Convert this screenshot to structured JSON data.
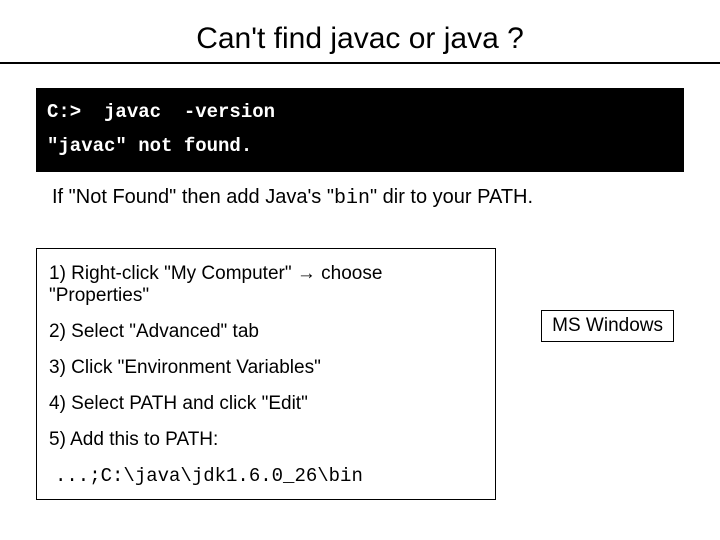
{
  "title": "Can't find javac or java ?",
  "terminal": {
    "line1": "C:>  javac  -version",
    "line2": "\"javac\" not found."
  },
  "instruction": {
    "prefix": "If \"Not Found\" then add Java's \"",
    "bin": "bin",
    "suffix": "\" dir to your PATH."
  },
  "steps": {
    "s1": "1) Right-click \"My Computer\" → choose \"Properties\"",
    "s2": "2) Select \"Advanced\" tab",
    "s3": "3) Click \"Environment Variables\"",
    "s4": "4) Select PATH and click \"Edit\"",
    "s5": "5) Add this to PATH:",
    "path": "...;C:\\java\\jdk1.6.0_26\\bin"
  },
  "os_label": "MS Windows"
}
